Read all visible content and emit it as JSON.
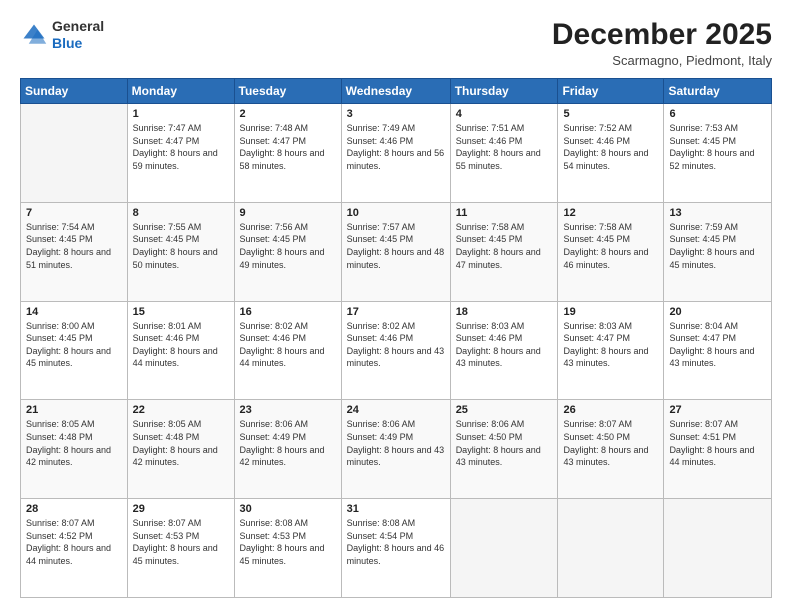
{
  "logo": {
    "general": "General",
    "blue": "Blue"
  },
  "title": "December 2025",
  "location": "Scarmagno, Piedmont, Italy",
  "weekdays": [
    "Sunday",
    "Monday",
    "Tuesday",
    "Wednesday",
    "Thursday",
    "Friday",
    "Saturday"
  ],
  "weeks": [
    [
      {
        "day": "",
        "sunrise": "",
        "sunset": "",
        "daylight": ""
      },
      {
        "day": "1",
        "sunrise": "7:47 AM",
        "sunset": "4:47 PM",
        "daylight": "8 hours and 59 minutes."
      },
      {
        "day": "2",
        "sunrise": "7:48 AM",
        "sunset": "4:47 PM",
        "daylight": "8 hours and 58 minutes."
      },
      {
        "day": "3",
        "sunrise": "7:49 AM",
        "sunset": "4:46 PM",
        "daylight": "8 hours and 56 minutes."
      },
      {
        "day": "4",
        "sunrise": "7:51 AM",
        "sunset": "4:46 PM",
        "daylight": "8 hours and 55 minutes."
      },
      {
        "day": "5",
        "sunrise": "7:52 AM",
        "sunset": "4:46 PM",
        "daylight": "8 hours and 54 minutes."
      },
      {
        "day": "6",
        "sunrise": "7:53 AM",
        "sunset": "4:45 PM",
        "daylight": "8 hours and 52 minutes."
      }
    ],
    [
      {
        "day": "7",
        "sunrise": "7:54 AM",
        "sunset": "4:45 PM",
        "daylight": "8 hours and 51 minutes."
      },
      {
        "day": "8",
        "sunrise": "7:55 AM",
        "sunset": "4:45 PM",
        "daylight": "8 hours and 50 minutes."
      },
      {
        "day": "9",
        "sunrise": "7:56 AM",
        "sunset": "4:45 PM",
        "daylight": "8 hours and 49 minutes."
      },
      {
        "day": "10",
        "sunrise": "7:57 AM",
        "sunset": "4:45 PM",
        "daylight": "8 hours and 48 minutes."
      },
      {
        "day": "11",
        "sunrise": "7:58 AM",
        "sunset": "4:45 PM",
        "daylight": "8 hours and 47 minutes."
      },
      {
        "day": "12",
        "sunrise": "7:58 AM",
        "sunset": "4:45 PM",
        "daylight": "8 hours and 46 minutes."
      },
      {
        "day": "13",
        "sunrise": "7:59 AM",
        "sunset": "4:45 PM",
        "daylight": "8 hours and 45 minutes."
      }
    ],
    [
      {
        "day": "14",
        "sunrise": "8:00 AM",
        "sunset": "4:45 PM",
        "daylight": "8 hours and 45 minutes."
      },
      {
        "day": "15",
        "sunrise": "8:01 AM",
        "sunset": "4:46 PM",
        "daylight": "8 hours and 44 minutes."
      },
      {
        "day": "16",
        "sunrise": "8:02 AM",
        "sunset": "4:46 PM",
        "daylight": "8 hours and 44 minutes."
      },
      {
        "day": "17",
        "sunrise": "8:02 AM",
        "sunset": "4:46 PM",
        "daylight": "8 hours and 43 minutes."
      },
      {
        "day": "18",
        "sunrise": "8:03 AM",
        "sunset": "4:46 PM",
        "daylight": "8 hours and 43 minutes."
      },
      {
        "day": "19",
        "sunrise": "8:03 AM",
        "sunset": "4:47 PM",
        "daylight": "8 hours and 43 minutes."
      },
      {
        "day": "20",
        "sunrise": "8:04 AM",
        "sunset": "4:47 PM",
        "daylight": "8 hours and 43 minutes."
      }
    ],
    [
      {
        "day": "21",
        "sunrise": "8:05 AM",
        "sunset": "4:48 PM",
        "daylight": "8 hours and 42 minutes."
      },
      {
        "day": "22",
        "sunrise": "8:05 AM",
        "sunset": "4:48 PM",
        "daylight": "8 hours and 42 minutes."
      },
      {
        "day": "23",
        "sunrise": "8:06 AM",
        "sunset": "4:49 PM",
        "daylight": "8 hours and 42 minutes."
      },
      {
        "day": "24",
        "sunrise": "8:06 AM",
        "sunset": "4:49 PM",
        "daylight": "8 hours and 43 minutes."
      },
      {
        "day": "25",
        "sunrise": "8:06 AM",
        "sunset": "4:50 PM",
        "daylight": "8 hours and 43 minutes."
      },
      {
        "day": "26",
        "sunrise": "8:07 AM",
        "sunset": "4:50 PM",
        "daylight": "8 hours and 43 minutes."
      },
      {
        "day": "27",
        "sunrise": "8:07 AM",
        "sunset": "4:51 PM",
        "daylight": "8 hours and 44 minutes."
      }
    ],
    [
      {
        "day": "28",
        "sunrise": "8:07 AM",
        "sunset": "4:52 PM",
        "daylight": "8 hours and 44 minutes."
      },
      {
        "day": "29",
        "sunrise": "8:07 AM",
        "sunset": "4:53 PM",
        "daylight": "8 hours and 45 minutes."
      },
      {
        "day": "30",
        "sunrise": "8:08 AM",
        "sunset": "4:53 PM",
        "daylight": "8 hours and 45 minutes."
      },
      {
        "day": "31",
        "sunrise": "8:08 AM",
        "sunset": "4:54 PM",
        "daylight": "8 hours and 46 minutes."
      },
      {
        "day": "",
        "sunrise": "",
        "sunset": "",
        "daylight": ""
      },
      {
        "day": "",
        "sunrise": "",
        "sunset": "",
        "daylight": ""
      },
      {
        "day": "",
        "sunrise": "",
        "sunset": "",
        "daylight": ""
      }
    ]
  ],
  "labels": {
    "sunrise": "Sunrise:",
    "sunset": "Sunset:",
    "daylight": "Daylight:"
  }
}
